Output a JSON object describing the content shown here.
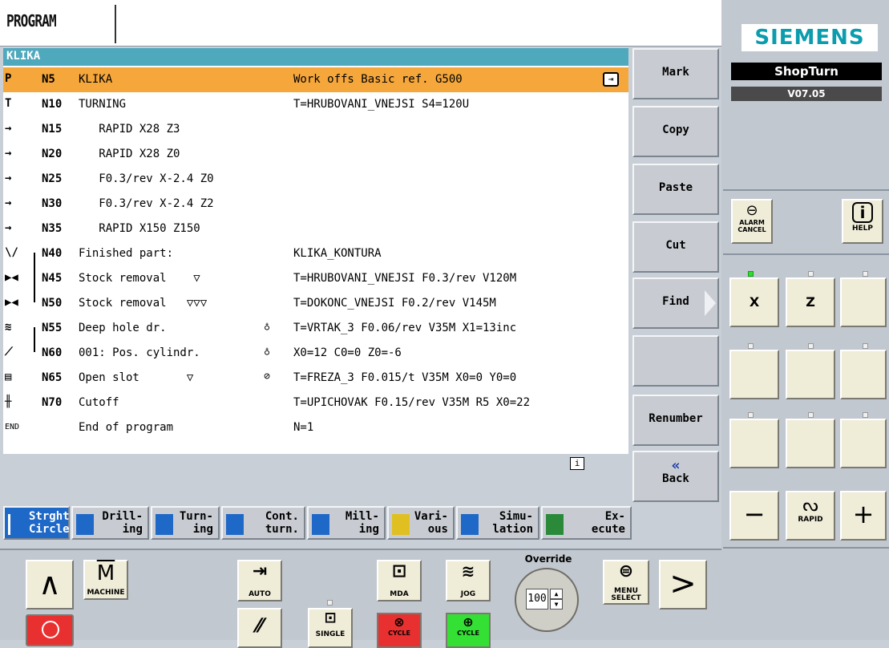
{
  "header": {
    "title": "PROGRAM",
    "program_name": "KLIKA"
  },
  "rows": [
    {
      "icon": "P",
      "num": "N5",
      "desc": "KLIKA",
      "sym": "",
      "param": "Work offs Basic ref. G500",
      "selected": true
    },
    {
      "icon": "T",
      "num": "N10",
      "desc": "TURNING",
      "sym": "",
      "param": "T=HRUBOVANI_VNEJSI S4=120U"
    },
    {
      "icon": "→",
      "num": "N15",
      "desc": "   RAPID X28 Z3",
      "sym": "",
      "param": ""
    },
    {
      "icon": "→",
      "num": "N20",
      "desc": "   RAPID X28 Z0",
      "sym": "",
      "param": ""
    },
    {
      "icon": "→",
      "num": "N25",
      "desc": "   F0.3/rev X-2.4 Z0",
      "sym": "",
      "param": ""
    },
    {
      "icon": "→",
      "num": "N30",
      "desc": "   F0.3/rev X-2.4 Z2",
      "sym": "",
      "param": ""
    },
    {
      "icon": "→",
      "num": "N35",
      "desc": "   RAPID X150 Z150",
      "sym": "",
      "param": ""
    },
    {
      "icon": "\\/",
      "num": "N40",
      "desc": "Finished part:",
      "sym": "",
      "param": "KLIKA_KONTURA"
    },
    {
      "icon": "▶◀",
      "num": "N45",
      "desc": "Stock removal    ▽",
      "sym": "",
      "param": "T=HRUBOVANI_VNEJSI F0.3/rev V120M"
    },
    {
      "icon": "▶◀",
      "num": "N50",
      "desc": "Stock removal   ▽▽▽",
      "sym": "",
      "param": "T=DOKONC_VNEJSI F0.2/rev V145M"
    },
    {
      "icon": "≋",
      "num": "N55",
      "desc": "Deep hole dr.",
      "sym": "♁",
      "param": "T=VRTAK_3 F0.06/rev V35M X1=13inc"
    },
    {
      "icon": "⟋",
      "num": "N60",
      "desc": "001: Pos. cylindr.",
      "sym": "♁",
      "param": "X0=12 C0=0 Z0=-6"
    },
    {
      "icon": "▤",
      "num": "N65",
      "desc": "Open slot       ▽",
      "sym": "⊘",
      "param": "T=FREZA_3 F0.015/t V35M X0=0 Y0=0"
    },
    {
      "icon": "╫",
      "num": "N70",
      "desc": "Cutoff",
      "sym": "",
      "param": "T=UPICHOVAK F0.15/rev V35M R5 X0=22"
    },
    {
      "icon": "END",
      "num": "",
      "desc": "End of program",
      "sym": "",
      "param": "N=1"
    }
  ],
  "softkeys_right": {
    "mark": "Mark",
    "copy": "Copy",
    "paste": "Paste",
    "cut": "Cut",
    "find": "Find",
    "renumber": "Renumber",
    "back": "Back"
  },
  "softkeys_bottom": [
    {
      "l1": "Strght",
      "l2": "Circle"
    },
    {
      "l1": "Drill-",
      "l2": "ing"
    },
    {
      "l1": "Turn-",
      "l2": "ing"
    },
    {
      "l1": "Cont.",
      "l2": "turn."
    },
    {
      "l1": "Mill-",
      "l2": "ing"
    },
    {
      "l1": "Vari-",
      "l2": "ous"
    },
    {
      "l1": "Simu-",
      "l2": "lation"
    },
    {
      "l1": "Ex-",
      "l2": "ecute"
    }
  ],
  "brand": {
    "siemens": "SIEMENS",
    "shopturn": "ShopTurn",
    "version": "V07.05"
  },
  "panel": {
    "alarm_cancel": "ALARM CANCEL",
    "help": "HELP",
    "axis_x": "X",
    "axis_z": "Z",
    "rapid": "RAPID",
    "minus": "−",
    "plus": "+"
  },
  "machine": {
    "machine": "MACHINE",
    "auto": "AUTO",
    "mda": "MDA",
    "jog": "JOG",
    "override_label": "Override",
    "override_value": "100",
    "menu_select": "MENU SELECT",
    "single": "SINGLE",
    "cycle_stop": "CYCLE",
    "cycle_start": "CYCLE"
  },
  "colors": {
    "selection": "#f5a73c",
    "title_bar": "#4fa9bd",
    "brand": "#0b9cad",
    "start_green": "#33e033",
    "stop_red": "#e83030"
  }
}
